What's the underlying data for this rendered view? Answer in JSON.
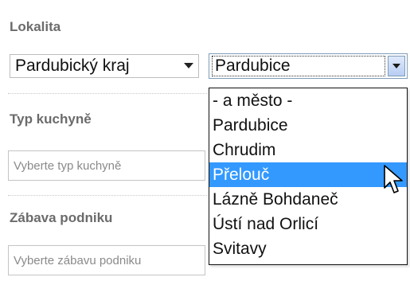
{
  "sections": {
    "lokalita": {
      "label": "Lokalita"
    },
    "cuisine": {
      "label": "Typ kuchyně",
      "placeholder": "Vyberte typ kuchyně"
    },
    "entertainment": {
      "label": "Zábava podniku",
      "placeholder": "Vyberte zábavu podniku"
    }
  },
  "region_select": {
    "value": "Pardubický kraj",
    "icon": "dropdown-arrow"
  },
  "city_select": {
    "value": "Pardubice",
    "icon": "dropdown-arrow"
  },
  "city_options": [
    {
      "label": "- a město -"
    },
    {
      "label": "Pardubice"
    },
    {
      "label": "Chrudim"
    },
    {
      "label": "Přelouč",
      "highlighted": true
    },
    {
      "label": "Lázně Bohdaneč"
    },
    {
      "label": "Ústí nad Orlicí"
    },
    {
      "label": "Svitavy"
    }
  ],
  "colors": {
    "highlight": "#3399ff",
    "label": "#6b6b6b"
  },
  "cursor": {
    "icon": "mouse-pointer"
  }
}
